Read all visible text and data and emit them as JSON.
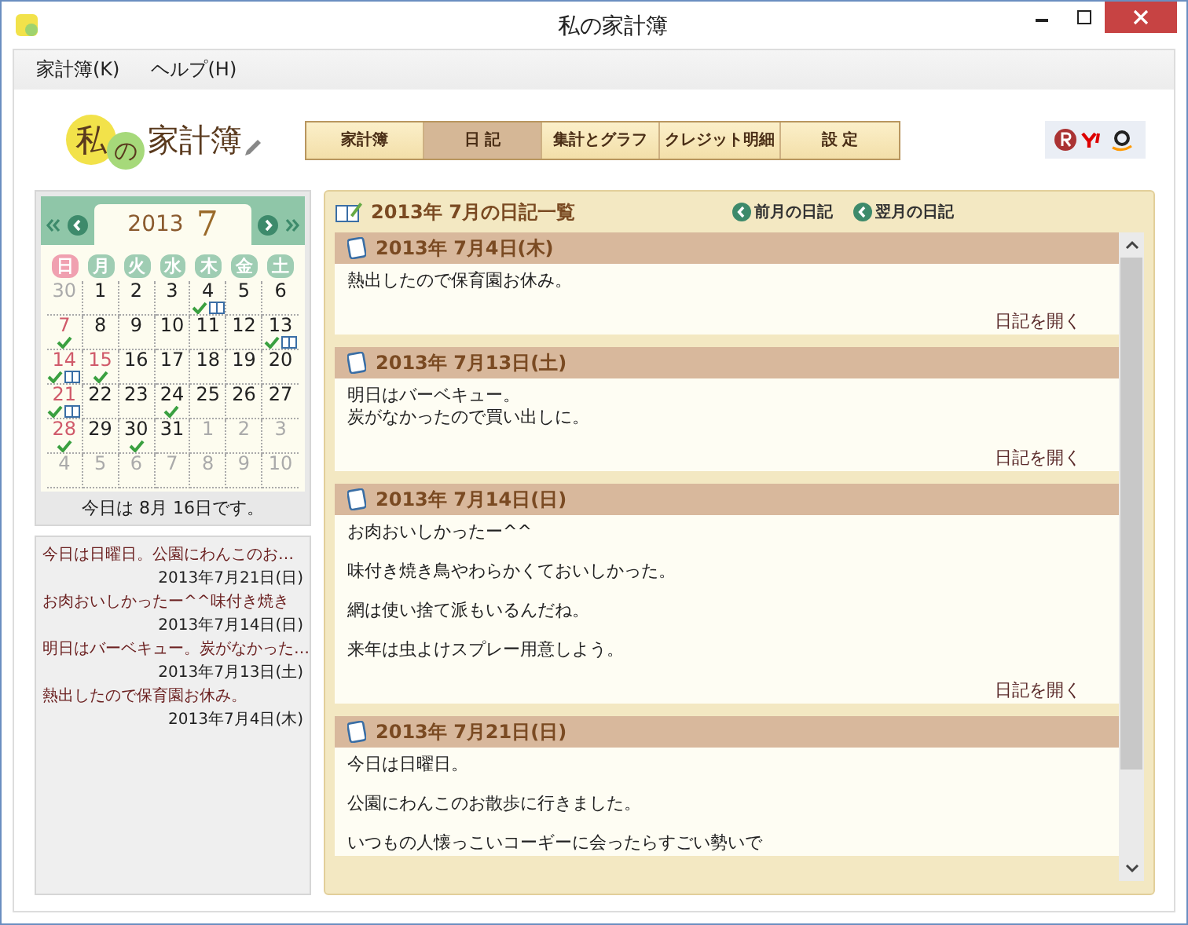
{
  "window": {
    "title": "私の家計簿"
  },
  "menu": [
    {
      "label": "家計簿(K)"
    },
    {
      "label": "ヘルプ(H)"
    }
  ],
  "logo": {
    "first": "私",
    "second": "の",
    "rest": "家計簿"
  },
  "tabs": [
    {
      "label": "家計簿",
      "selected": false
    },
    {
      "label": "日 記",
      "selected": true
    },
    {
      "label": "集計とグラフ",
      "selected": false
    },
    {
      "label": "クレジット明細",
      "selected": false
    },
    {
      "label": "設 定",
      "selected": false
    }
  ],
  "calendar": {
    "year": "2013",
    "month": "7",
    "weekdays": [
      {
        "label": "日",
        "kind": "red"
      },
      {
        "label": "月",
        "kind": "weekday"
      },
      {
        "label": "火",
        "kind": "weekday"
      },
      {
        "label": "水",
        "kind": "weekday"
      },
      {
        "label": "木",
        "kind": "weekday"
      },
      {
        "label": "金",
        "kind": "weekday"
      },
      {
        "label": "土",
        "kind": "weekday"
      }
    ],
    "weeks": [
      [
        {
          "day": "30",
          "kind": "other",
          "check": false,
          "diary": false
        },
        {
          "day": "1",
          "kind": "weekday",
          "check": false,
          "diary": false
        },
        {
          "day": "2",
          "kind": "weekday",
          "check": false,
          "diary": false
        },
        {
          "day": "3",
          "kind": "weekday",
          "check": false,
          "diary": false
        },
        {
          "day": "4",
          "kind": "weekday",
          "check": true,
          "diary": true
        },
        {
          "day": "5",
          "kind": "weekday",
          "check": false,
          "diary": false
        },
        {
          "day": "6",
          "kind": "weekday",
          "check": false,
          "diary": false
        }
      ],
      [
        {
          "day": "7",
          "kind": "red",
          "check": true,
          "diary": false
        },
        {
          "day": "8",
          "kind": "weekday",
          "check": false,
          "diary": false
        },
        {
          "day": "9",
          "kind": "weekday",
          "check": false,
          "diary": false
        },
        {
          "day": "10",
          "kind": "weekday",
          "check": false,
          "diary": false
        },
        {
          "day": "11",
          "kind": "weekday",
          "check": false,
          "diary": false
        },
        {
          "day": "12",
          "kind": "weekday",
          "check": false,
          "diary": false
        },
        {
          "day": "13",
          "kind": "weekday",
          "check": true,
          "diary": true
        }
      ],
      [
        {
          "day": "14",
          "kind": "red",
          "check": true,
          "diary": true
        },
        {
          "day": "15",
          "kind": "red",
          "check": true,
          "diary": false
        },
        {
          "day": "16",
          "kind": "weekday",
          "check": false,
          "diary": false
        },
        {
          "day": "17",
          "kind": "weekday",
          "check": false,
          "diary": false
        },
        {
          "day": "18",
          "kind": "weekday",
          "check": false,
          "diary": false
        },
        {
          "day": "19",
          "kind": "weekday",
          "check": false,
          "diary": false
        },
        {
          "day": "20",
          "kind": "weekday",
          "check": false,
          "diary": false
        }
      ],
      [
        {
          "day": "21",
          "kind": "red",
          "check": true,
          "diary": true
        },
        {
          "day": "22",
          "kind": "weekday",
          "check": false,
          "diary": false
        },
        {
          "day": "23",
          "kind": "weekday",
          "check": false,
          "diary": false
        },
        {
          "day": "24",
          "kind": "weekday",
          "check": true,
          "diary": false
        },
        {
          "day": "25",
          "kind": "weekday",
          "check": false,
          "diary": false
        },
        {
          "day": "26",
          "kind": "weekday",
          "check": false,
          "diary": false
        },
        {
          "day": "27",
          "kind": "weekday",
          "check": false,
          "diary": false
        }
      ],
      [
        {
          "day": "28",
          "kind": "red",
          "check": true,
          "diary": false
        },
        {
          "day": "29",
          "kind": "weekday",
          "check": false,
          "diary": false
        },
        {
          "day": "30",
          "kind": "weekday",
          "check": true,
          "diary": false
        },
        {
          "day": "31",
          "kind": "weekday",
          "check": false,
          "diary": false
        },
        {
          "day": "1",
          "kind": "other",
          "check": false,
          "diary": false
        },
        {
          "day": "2",
          "kind": "other",
          "check": false,
          "diary": false
        },
        {
          "day": "3",
          "kind": "other",
          "check": false,
          "diary": false
        }
      ],
      [
        {
          "day": "4",
          "kind": "other",
          "check": false,
          "diary": false
        },
        {
          "day": "5",
          "kind": "other",
          "check": false,
          "diary": false
        },
        {
          "day": "6",
          "kind": "other",
          "check": false,
          "diary": false
        },
        {
          "day": "7",
          "kind": "other",
          "check": false,
          "diary": false
        },
        {
          "day": "8",
          "kind": "other",
          "check": false,
          "diary": false
        },
        {
          "day": "9",
          "kind": "other",
          "check": false,
          "diary": false
        },
        {
          "day": "10",
          "kind": "other",
          "check": false,
          "diary": false
        }
      ]
    ],
    "today": "今日は 8月 16日です。"
  },
  "recent": [
    {
      "text": "今日は日曜日。公園にわんこのお…",
      "date": "2013年7月21日(日)"
    },
    {
      "text": "お肉おいしかったー^^味付き焼き",
      "date": "2013年7月14日(日)"
    },
    {
      "text": "明日はバーベキュー。炭がなかった…",
      "date": "2013年7月13日(土)"
    },
    {
      "text": "熱出したので保育園お休み。",
      "date": "2013年7月4日(木)"
    }
  ],
  "diary": {
    "title": "2013年 7月の日記一覧",
    "prev": "前月の日記",
    "next": "翌月の日記",
    "entries": [
      {
        "date": "2013年 7月4日(木)",
        "paragraphs": [
          [
            "熱出したので保育園お休み。"
          ]
        ],
        "open": "日記を開く"
      },
      {
        "date": "2013年 7月13日(土)",
        "paragraphs": [
          [
            "明日はバーベキュー。",
            "炭がなかったので買い出しに。"
          ]
        ],
        "open": "日記を開く"
      },
      {
        "date": "2013年 7月14日(日)",
        "paragraphs": [
          [
            "お肉おいしかったー^^"
          ],
          [
            "味付き焼き鳥やわらかくておいしかった。"
          ],
          [
            "網は使い捨て派もいるんだね。"
          ],
          [
            "来年は虫よけスプレー用意しよう。"
          ]
        ],
        "open": "日記を開く"
      },
      {
        "date": "2013年 7月21日(日)",
        "paragraphs": [
          [
            "今日は日曜日。"
          ],
          [
            "公園にわんこのお散歩に行きました。"
          ],
          [
            "いつもの人懐っこいコーギーに会ったらすごい勢いで"
          ]
        ]
      }
    ]
  }
}
